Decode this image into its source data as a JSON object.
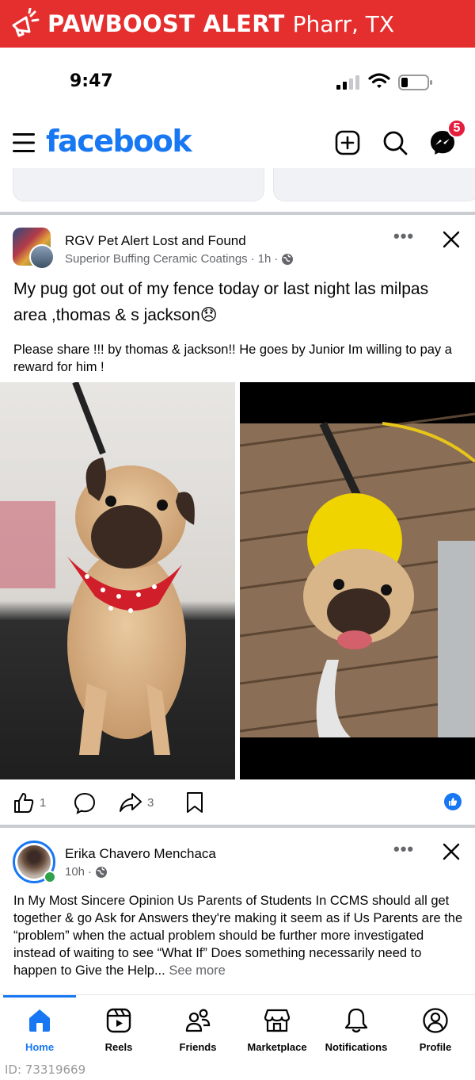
{
  "banner": {
    "title": "PAWBOOST ALERT",
    "location": "Pharr, TX",
    "icon": "megaphone-icon",
    "color": "#e52e2e"
  },
  "status_bar": {
    "time": "9:47"
  },
  "header": {
    "logo": "facebook",
    "messenger_badge": "5",
    "brand_color": "#1877f2"
  },
  "post1": {
    "group_name": "RGV Pet Alert Lost and Found",
    "author": "Superior Buffing Ceramic Coatings",
    "time": "1h",
    "title": "My pug got out of my fence today or last night las milpas area ,thomas & s jackson😞",
    "body": "Please share !!! by thomas & jackson!! He goes by Junior Im willing to pay a reward for him !",
    "like_count": "1",
    "share_count": "3"
  },
  "post2": {
    "author": "Erika Chavero Menchaca",
    "time": "10h",
    "body": "In My Most Sincere Opinion Us Parents of Students In CCMS should all get together & go Ask for Answers they're making it seem as if Us Parents are the “problem” when the actual problem should be further more investigated instead of waiting to see “What If” Does something necessarily need to happen to Give the Help...",
    "see_more": "See more"
  },
  "nav": {
    "items": [
      {
        "label": "Home",
        "icon": "home-icon"
      },
      {
        "label": "Reels",
        "icon": "reels-icon"
      },
      {
        "label": "Friends",
        "icon": "friends-icon"
      },
      {
        "label": "Marketplace",
        "icon": "marketplace-icon"
      },
      {
        "label": "Notifications",
        "icon": "bell-icon"
      },
      {
        "label": "Profile",
        "icon": "profile-icon"
      }
    ]
  },
  "footer_id": "ID: 73319669"
}
